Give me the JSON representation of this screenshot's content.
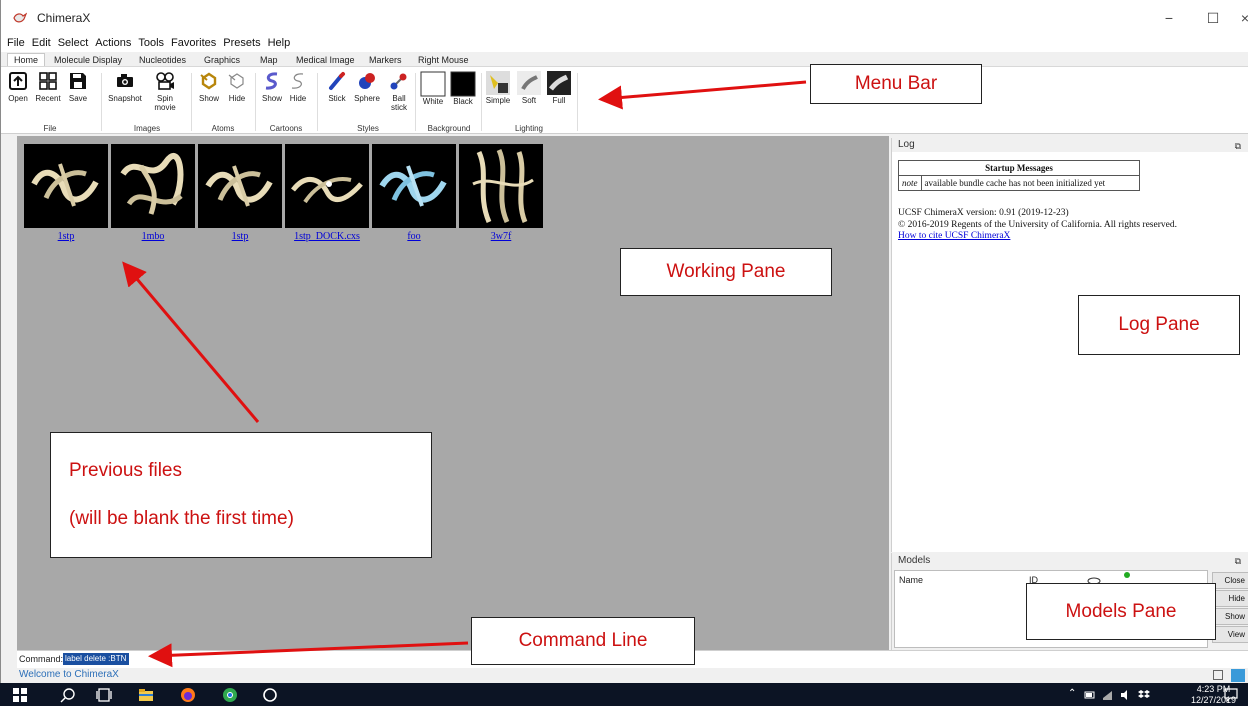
{
  "window": {
    "title": "ChimeraX",
    "minimize": "−",
    "maximize": "☐",
    "close": "×"
  },
  "menu": [
    "File",
    "Edit",
    "Select",
    "Actions",
    "Tools",
    "Favorites",
    "Presets",
    "Help"
  ],
  "tabs": [
    "Home",
    "Molecule Display",
    "Nucleotides",
    "Graphics",
    "Map",
    "Medical Image",
    "Markers",
    "Right Mouse"
  ],
  "toolbar": {
    "groups": {
      "file": "File",
      "images": "Images",
      "atoms": "Atoms",
      "cartoons": "Cartoons",
      "styles": "Styles",
      "background": "Background",
      "lighting": "Lighting"
    },
    "buttons": {
      "open": "Open",
      "recent": "Recent",
      "save": "Save",
      "snapshot": "Snapshot",
      "spin_movie_1": "Spin",
      "spin_movie_2": "movie",
      "atoms_show": "Show",
      "atoms_hide": "Hide",
      "cartoons_show": "Show",
      "cartoons_hide": "Hide",
      "stick": "Stick",
      "sphere": "Sphere",
      "ball_stick_1": "Ball",
      "ball_stick_2": "stick",
      "white": "White",
      "black": "Black",
      "simple": "Simple",
      "soft": "Soft",
      "full": "Full"
    }
  },
  "previous_files": [
    "1stp",
    "1mbo",
    "1stp",
    "1stp_DOCK.cxs",
    "foo",
    "3w7f"
  ],
  "log": {
    "title": "Log",
    "table_header": "Startup Messages",
    "note_label": "note",
    "note_text": "available bundle cache has not been initialized yet",
    "version": "UCSF ChimeraX version: 0.91 (2019-12-23)",
    "copyright": "© 2016-2019 Regents of the University of California. All rights reserved.",
    "cite_link": "How to cite UCSF ChimeraX"
  },
  "models": {
    "title": "Models",
    "col_name": "Name",
    "col_id": "ID",
    "buttons": [
      "Close",
      "Hide",
      "Show",
      "View"
    ]
  },
  "command": {
    "label": "Command:",
    "value": "label delete :BTN"
  },
  "status": "Welcome to ChimeraX",
  "taskbar": {
    "time": "4:23 PM",
    "date": "12/27/2019"
  },
  "annotations": {
    "menu_bar": "Menu Bar",
    "working_pane": "Working Pane",
    "log_pane": "Log Pane",
    "previous_files_1": "Previous files",
    "previous_files_2": "(will be blank the first time)",
    "models_pane": "Models Pane",
    "command_line": "Command Line"
  },
  "colors": {
    "annotation_red": "#cc1111",
    "working_gray": "#a8a8a8",
    "link_blue": "#0000d8"
  }
}
